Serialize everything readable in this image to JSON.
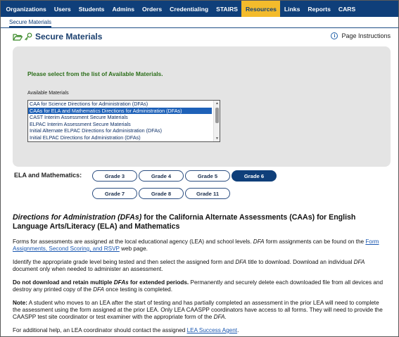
{
  "nav": {
    "items": [
      {
        "label": "Organizations",
        "active": false
      },
      {
        "label": "Users",
        "active": false
      },
      {
        "label": "Students",
        "active": false
      },
      {
        "label": "Admins",
        "active": false
      },
      {
        "label": "Orders",
        "active": false
      },
      {
        "label": "Credentialing",
        "active": false
      },
      {
        "label": "STAIRS",
        "active": false
      },
      {
        "label": "Resources",
        "active": true
      },
      {
        "label": "Links",
        "active": false
      },
      {
        "label": "Reports",
        "active": false
      },
      {
        "label": "CARS",
        "active": false
      }
    ]
  },
  "subnav": {
    "tab": "Secure Materials"
  },
  "page": {
    "title": "Secure Materials",
    "instructions_link": "Page Instructions",
    "icons": [
      "folder-open-icon",
      "key-icon",
      "info-icon"
    ]
  },
  "panel": {
    "prompt": "Please select from the list of Available Materials.",
    "list_label": "Available Materials",
    "options": [
      "CAA for Science Directions for Administration (DFAs)",
      "CAAs for ELA and Mathematics Directions for Administration (DFAs)",
      "CAST Interim Assessment Secure Materials",
      "ELPAC Interim Assessment Secure Materials",
      "Initial Alternate ELPAC Directions for Administration (DFAs)",
      "Initial ELPAC Directions for Administration (DFAs)"
    ],
    "selected_index": 1
  },
  "grades": {
    "label": "ELA and Mathematics:",
    "buttons": [
      "Grade 3",
      "Grade 4",
      "Grade 5",
      "Grade 6",
      "Grade 7",
      "Grade 8",
      "Grade 11"
    ],
    "active": "Grade 6"
  },
  "doc": {
    "heading_italic": "Directions for Administration (DFAs)",
    "heading_rest": " for the California Alternate Assessments (CAAs) for English Language Arts/Literacy (ELA) and Mathematics",
    "p1_a": "Forms for assessments are assigned at the local educational agency (LEA) and school levels. ",
    "p1_b": "DFA",
    "p1_c": " form assignments can be found on the ",
    "p1_link": "Form Assignments, Second Scoring, and RSVP",
    "p1_d": " web page.",
    "p2_a": "Identify the appropriate grade level being tested and then select the assigned form and ",
    "p2_b": "DFA",
    "p2_c": " title to download. Download an individual ",
    "p2_d": "DFA",
    "p2_e": " document only when needed to administer an assessment.",
    "p3_bold_a": "Do not download and retain multiple ",
    "p3_bold_b": "DFAs",
    "p3_bold_c": " for extended periods.",
    "p3_a": " Permanently and securely delete each downloaded file from all devices and destroy any printed copy of the ",
    "p3_b": "DFA",
    "p3_c": " once testing is completed.",
    "p4_bold": "Note:",
    "p4_a": " A student who moves to an LEA after the start of testing and has partially completed an assessment in the prior LEA will need to complete the assessment using the form assigned at the prior LEA. Only LEA CAASPP coordinators have access to all forms. They will need to provide the CAASPP test site coordinator or test examiner with the appropriate form of the ",
    "p4_b": "DFA",
    "p4_c": ".",
    "p5_a": "For additional help, an LEA coordinator should contact the assigned ",
    "p5_link": "LEA Success Agent",
    "p5_b": "."
  },
  "colors": {
    "nav_bg": "#0f3f7a",
    "nav_active": "#f3bb2c",
    "prompt_green": "#2c6e1a",
    "link": "#1a57b0"
  }
}
